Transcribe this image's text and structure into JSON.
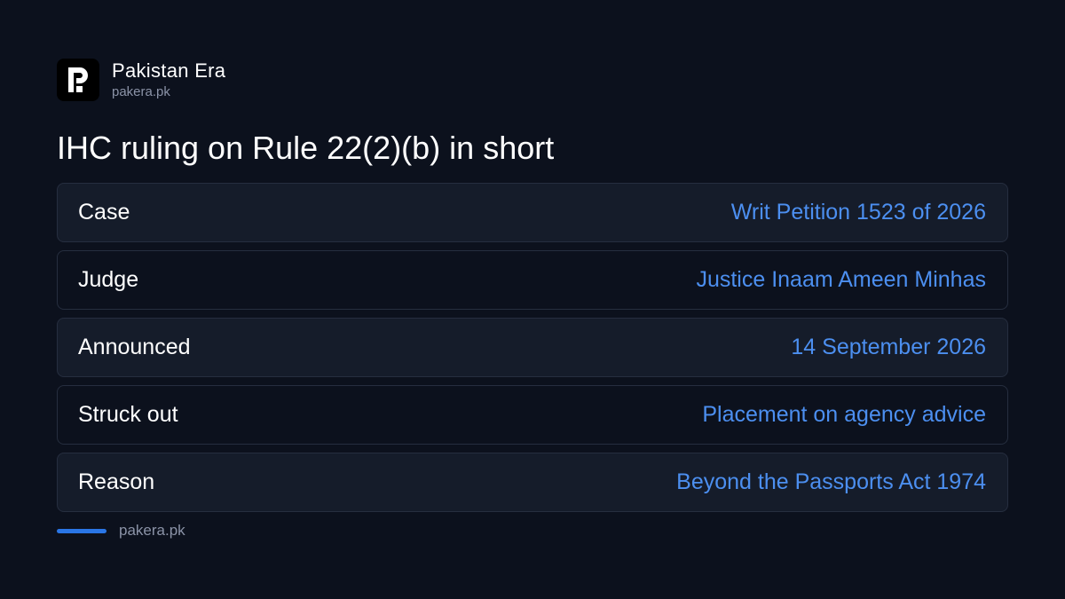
{
  "brand": {
    "name": "Pakistan Era",
    "domain": "pakera.pk",
    "logo_icon": "pakistan-era-logo-icon"
  },
  "headline": "IHC ruling on Rule 22(2)(b) in short",
  "rows": [
    {
      "label": "Case",
      "value": "Writ Petition 1523 of 2026"
    },
    {
      "label": "Judge",
      "value": "Justice Inaam Ameen Minhas"
    },
    {
      "label": "Announced",
      "value": "14 September 2026"
    },
    {
      "label": "Struck out",
      "value": "Placement on agency advice"
    },
    {
      "label": "Reason",
      "value": "Beyond the Passports Act 1974"
    }
  ],
  "footer": {
    "domain": "pakera.pk"
  },
  "colors": {
    "background": "#0c111d",
    "row_shaded": "#151c2a",
    "value_text": "#4c8ff0",
    "accent": "#2a76e6",
    "muted_text": "#8b93a7"
  }
}
